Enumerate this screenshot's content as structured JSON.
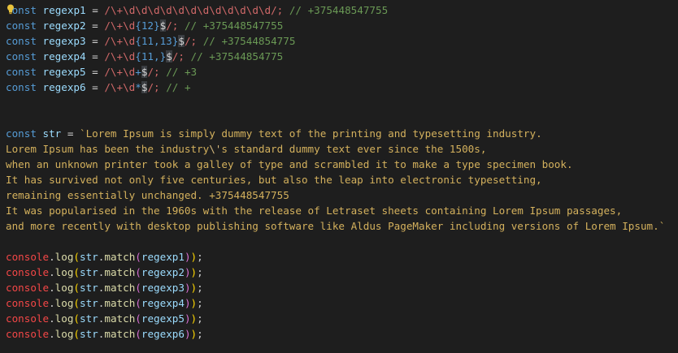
{
  "editor": {
    "lines": [
      {
        "kw": "const",
        "name": "regexp1",
        "eq": " = ",
        "rx_start": "/\\+\\d\\d\\d\\d\\d\\d\\d\\d\\d\\d\\d\\d",
        "rx_end": "/;",
        "comment": " // +375448547755"
      },
      {
        "kw": "const",
        "name": "regexp2",
        "eq": " = ",
        "rx_a": "/\\+\\d",
        "rx_q": "{12}",
        "rx_sel": "$",
        "rx_end": "/;",
        "comment": " // +375448547755"
      },
      {
        "kw": "const",
        "name": "regexp3",
        "eq": " = ",
        "rx_a": "/\\+\\d",
        "rx_q": "{11,13}",
        "rx_sel": "$",
        "rx_end": "/;",
        "comment": " // +37544854775"
      },
      {
        "kw": "const",
        "name": "regexp4",
        "eq": " = ",
        "rx_a": "/\\+\\d",
        "rx_q": "{11,}",
        "rx_sel": "$",
        "rx_end": "/;",
        "comment": " // +37544854775"
      },
      {
        "kw": "const",
        "name": "regexp5",
        "eq": " = ",
        "rx_a": "/\\+\\d",
        "rx_q": "+",
        "rx_sel": "$",
        "rx_end": "/;",
        "comment": " // +3"
      },
      {
        "kw": "const",
        "name": "regexp6",
        "eq": " = ",
        "rx_a": "/\\+\\d",
        "rx_q": "*",
        "rx_sel": "$",
        "rx_end": "/;",
        "comment": " // +"
      }
    ],
    "str_decl": {
      "kw": "const",
      "name": "str",
      "eq": " = "
    },
    "template_lines": [
      "`Lorem Ipsum is simply dummy text of the printing and typesetting industry.",
      "Lorem Ipsum has been the industry",
      "when an unknown printer took a galley of type and scrambled it to make a type specimen book.",
      "It has survived not only five centuries, but also the leap into electronic typesetting,",
      "remaining essentially unchanged. +375448547755",
      "It was popularised in the 1960s with the release of Letraset sheets containing Lorem Ipsum passages,",
      "and more recently with desktop publishing software like Aldus PageMaker including versions of Lorem Ipsum.`"
    ],
    "template_escape": "\\'",
    "template_line2_rest": "s standard dummy text ever since the 1500s,",
    "console_calls": [
      {
        "obj": "console",
        "method": "log",
        "arg_obj": "str",
        "arg_method": "match",
        "arg": "regexp1"
      },
      {
        "obj": "console",
        "method": "log",
        "arg_obj": "str",
        "arg_method": "match",
        "arg": "regexp2"
      },
      {
        "obj": "console",
        "method": "log",
        "arg_obj": "str",
        "arg_method": "match",
        "arg": "regexp3"
      },
      {
        "obj": "console",
        "method": "log",
        "arg_obj": "str",
        "arg_method": "match",
        "arg": "regexp4"
      },
      {
        "obj": "console",
        "method": "log",
        "arg_obj": "str",
        "arg_method": "match",
        "arg": "regexp5"
      },
      {
        "obj": "console",
        "method": "log",
        "arg_obj": "str",
        "arg_method": "match",
        "arg": "regexp6"
      }
    ],
    "semicolon": ";",
    "dot": ".",
    "open_paren": "(",
    "close_paren": ")",
    "lightbulb_icon": "lightbulb-icon"
  },
  "colors": {
    "background": "#1e1e1e",
    "keyword": "#569cd6",
    "variable": "#9cdcfe",
    "regex": "#d16969",
    "comment": "#6a9955",
    "template_string": "#d4b15d",
    "console_object": "#f44747",
    "function": "#dcdcaa"
  }
}
